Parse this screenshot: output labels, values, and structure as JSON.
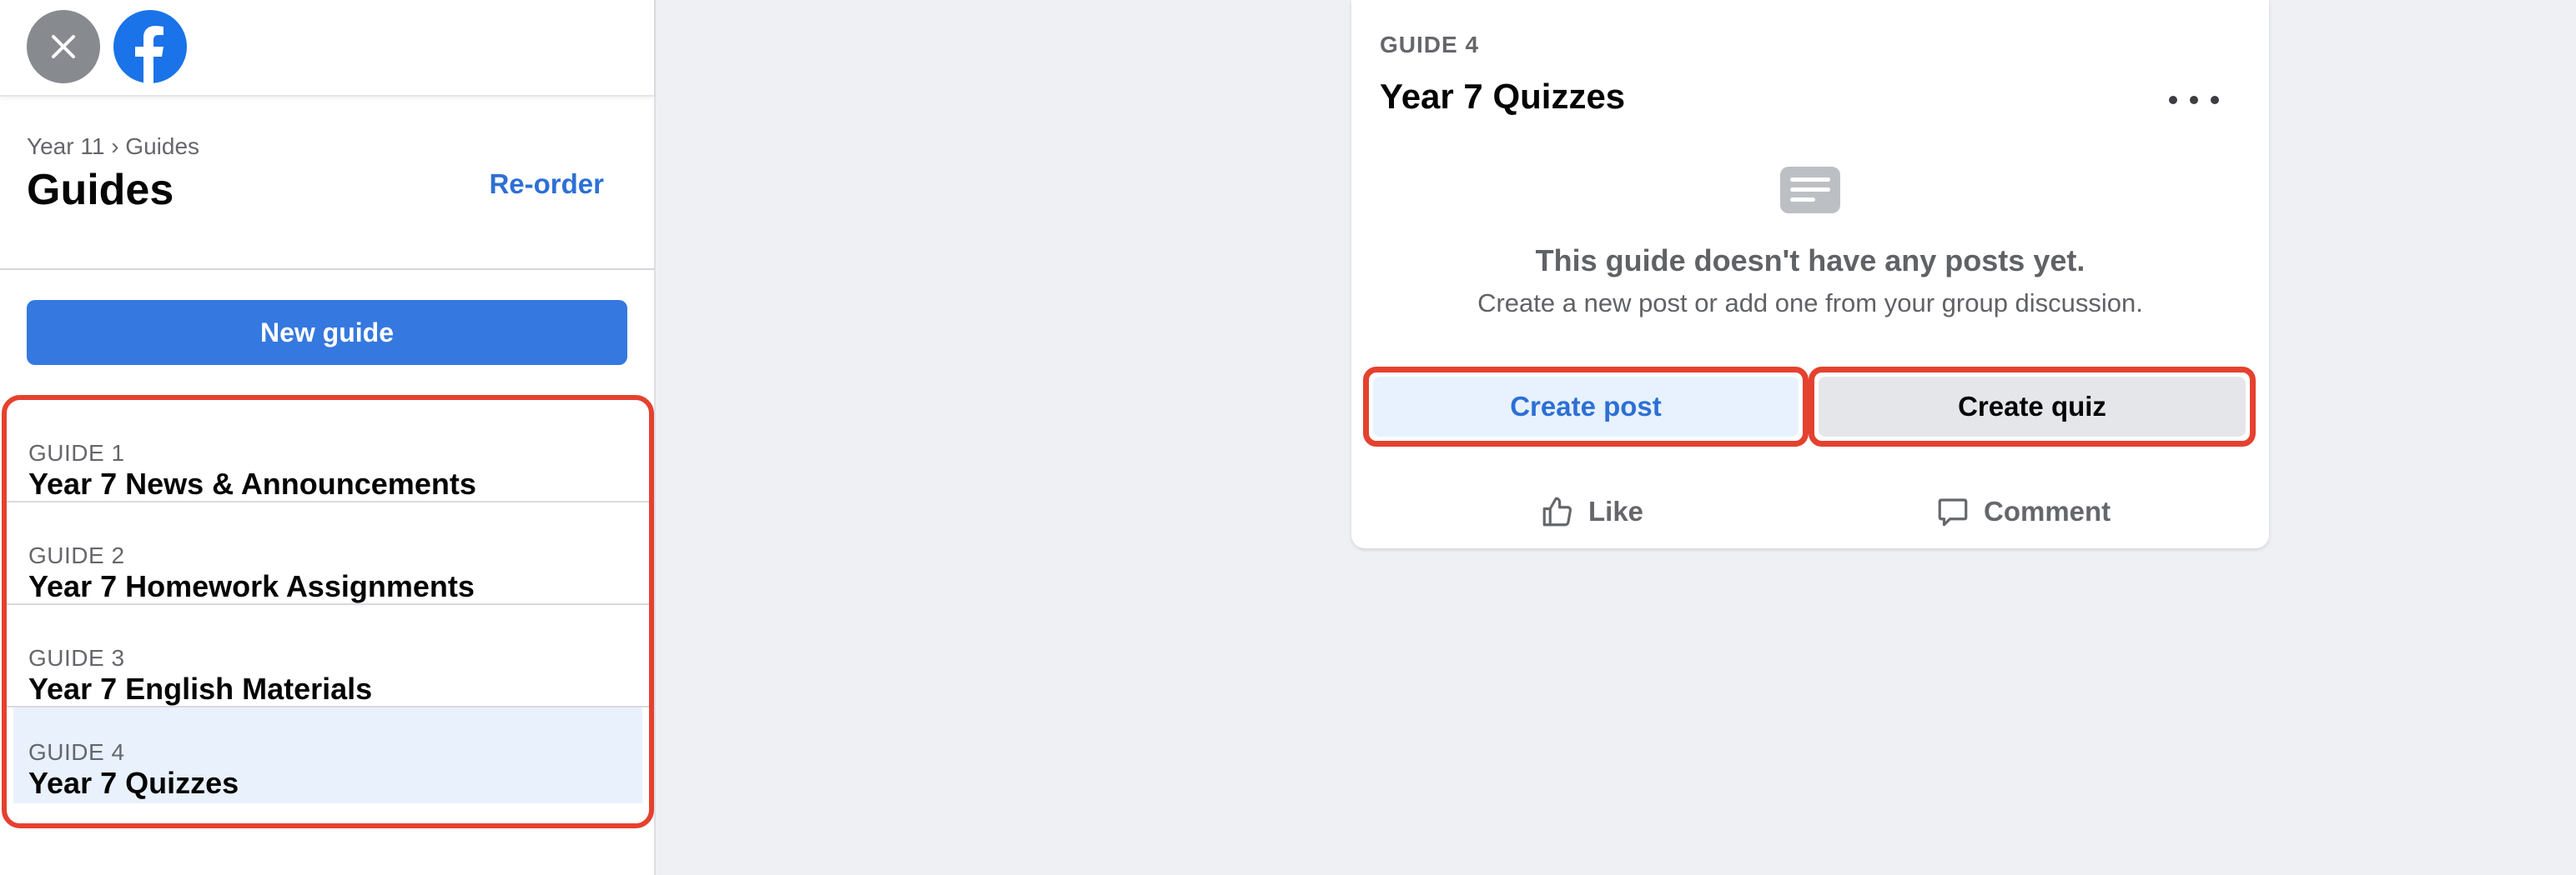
{
  "topbar": {
    "close_icon": "close-icon",
    "logo": "facebook-logo-icon"
  },
  "header": {
    "breadcrumb": "Year 11 › Guides",
    "title": "Guides",
    "reorder_label": "Re-order"
  },
  "sidebar": {
    "new_guide_label": "New guide",
    "guides": [
      {
        "number": "GUIDE 1",
        "title": "Year 7 News & Announcements"
      },
      {
        "number": "GUIDE 2",
        "title": "Year 7 Homework Assignments"
      },
      {
        "number": "GUIDE 3",
        "title": "Year 7 English Materials"
      },
      {
        "number": "GUIDE 4",
        "title": "Year 7 Quizzes"
      }
    ]
  },
  "card": {
    "kicker": "GUIDE 4",
    "title": "Year 7 Quizzes",
    "empty_title": "This guide doesn't have any posts yet.",
    "empty_subtitle": "Create a new post or add one from your group discussion.",
    "create_post_label": "Create post",
    "create_quiz_label": "Create quiz",
    "like_label": "Like",
    "comment_label": "Comment"
  },
  "colors": {
    "accent": "#3578e0",
    "highlight_outline": "#e5412f",
    "active_item_bg": "#e9f1fd"
  }
}
